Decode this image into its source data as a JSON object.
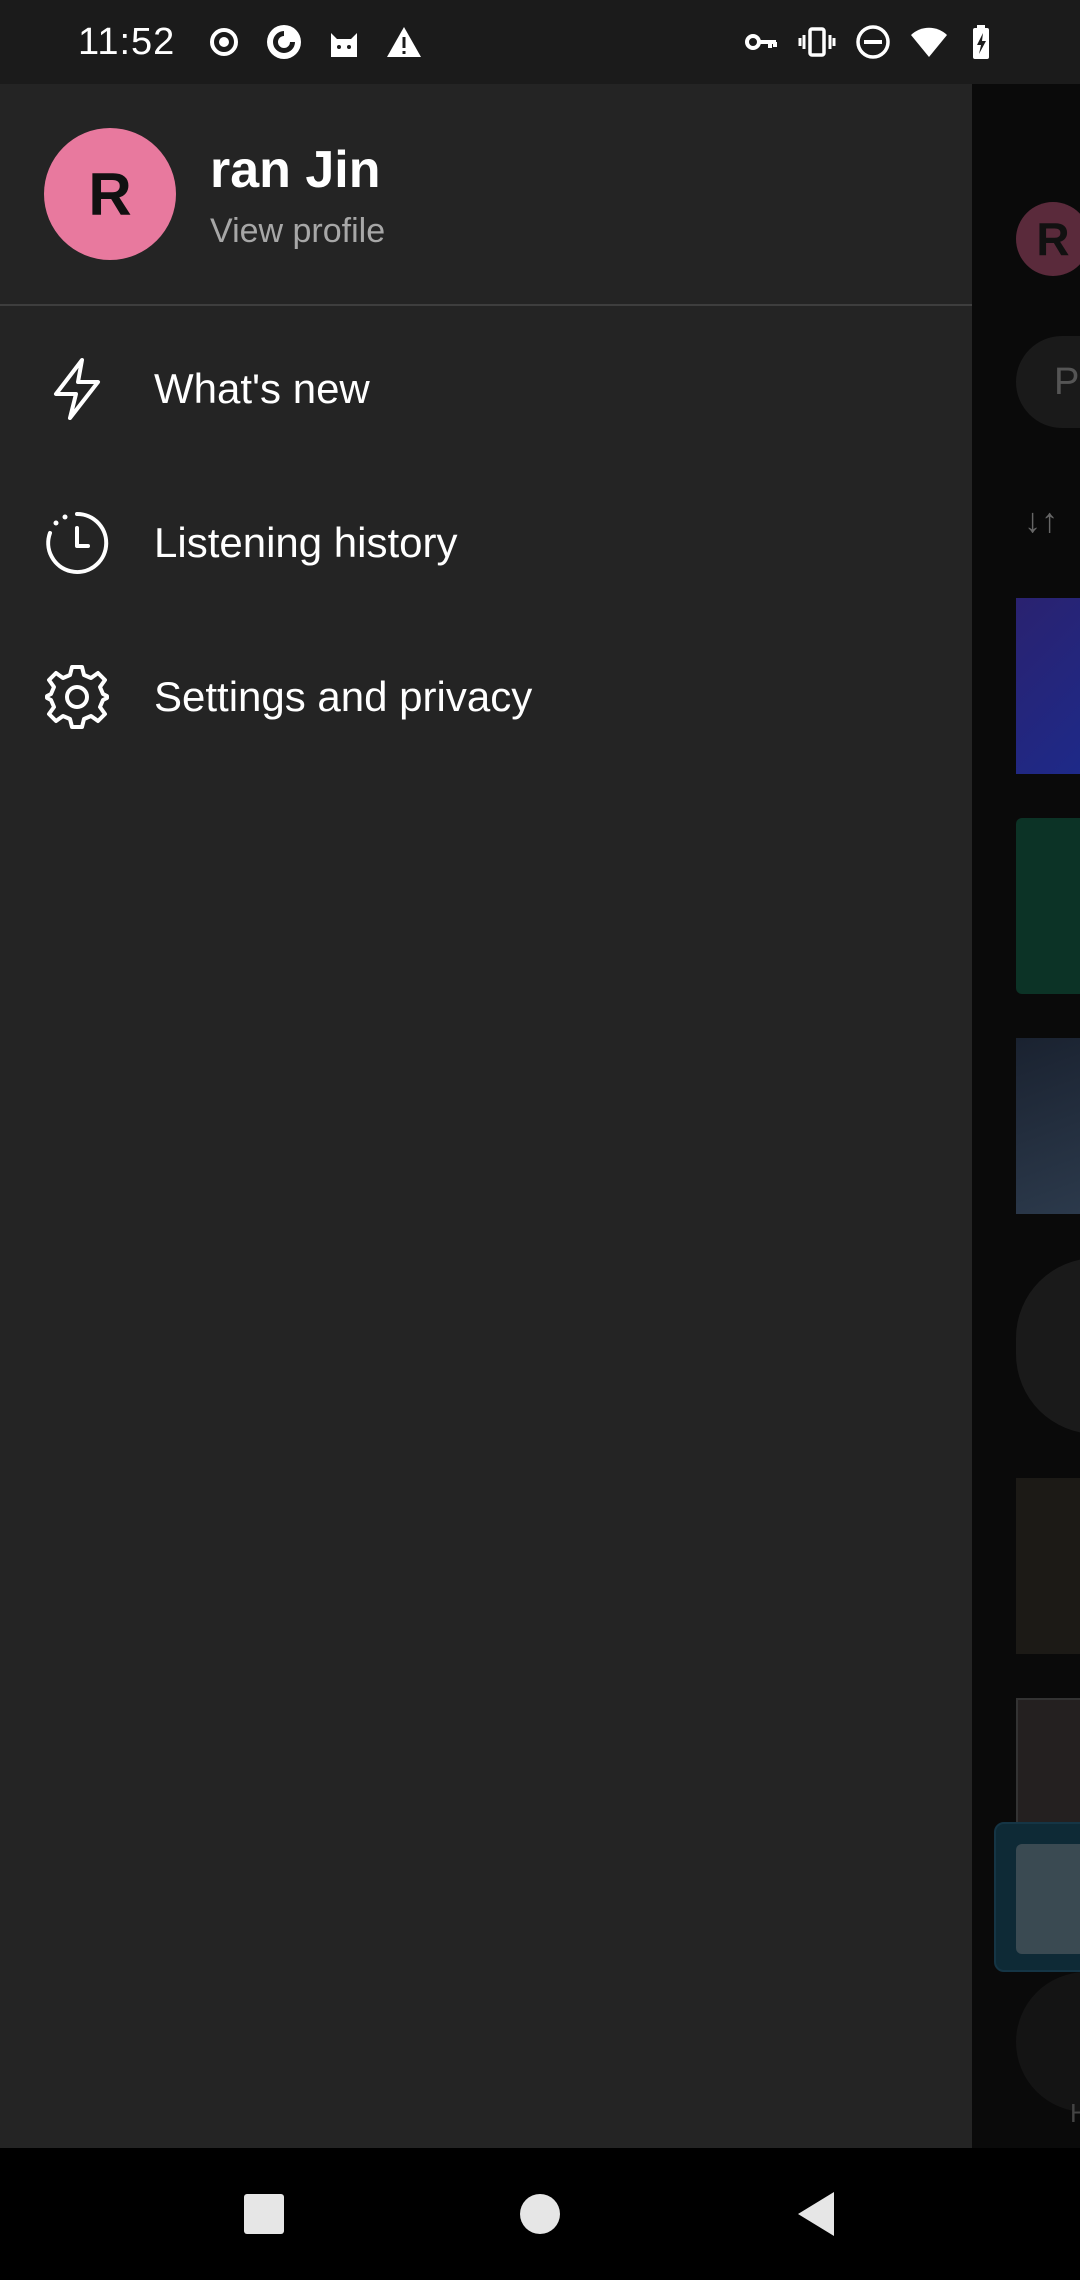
{
  "status_bar": {
    "time": "11:52",
    "left_icons": [
      "record-icon",
      "pocket-casts-icon",
      "cat-app-icon",
      "warning-icon"
    ],
    "right_icons": [
      "vpn-key-icon",
      "vibrate-icon",
      "do-not-disturb-icon",
      "wifi-icon",
      "battery-charging-icon"
    ]
  },
  "drawer": {
    "profile": {
      "avatar_letter": "R",
      "avatar_color": "#e8799e",
      "name": "ran Jin",
      "subtitle": "View profile"
    },
    "menu": [
      {
        "icon": "lightning-icon",
        "label": "What's new"
      },
      {
        "icon": "clock-history-icon",
        "label": "Listening history"
      },
      {
        "icon": "gear-icon",
        "label": "Settings and privacy"
      }
    ]
  },
  "background": {
    "avatar_letter": "R",
    "chip_letter": "P",
    "sort_label": "↓↑",
    "bottom_label": "H"
  },
  "colors": {
    "drawer_bg": "#242424",
    "status_bg": "#1b1b1b",
    "subtitle_text": "#a7a7a7"
  }
}
